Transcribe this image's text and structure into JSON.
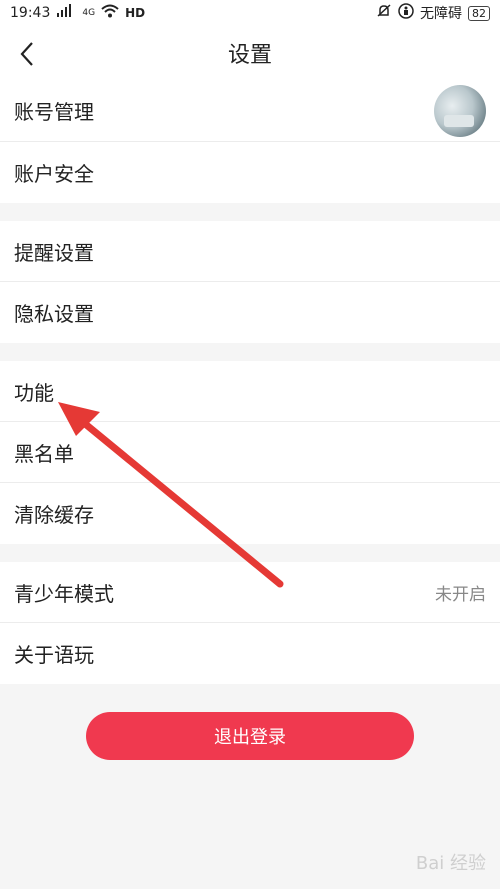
{
  "status_bar": {
    "time": "19:43",
    "network": "4G",
    "hd": "HD",
    "no_disturb_label": "无障碍",
    "battery": "82"
  },
  "header": {
    "title": "设置"
  },
  "groups": [
    {
      "items": [
        {
          "label": "账号管理"
        },
        {
          "label": "账户安全"
        }
      ]
    },
    {
      "items": [
        {
          "label": "提醒设置"
        },
        {
          "label": "隐私设置"
        }
      ]
    },
    {
      "items": [
        {
          "label": "功能"
        },
        {
          "label": "黑名单"
        },
        {
          "label": "清除缓存"
        }
      ]
    },
    {
      "items": [
        {
          "label": "青少年模式",
          "value": "未开启"
        },
        {
          "label": "关于语玩"
        }
      ]
    }
  ],
  "logout_label": "退出登录",
  "watermark": "Bai 经验",
  "colors": {
    "accent": "#f0394f",
    "arrow": "#e53935"
  }
}
